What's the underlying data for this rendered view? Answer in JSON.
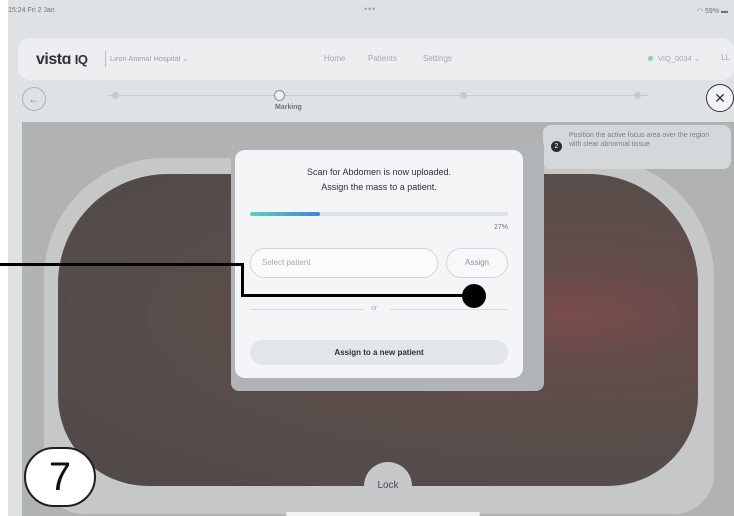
{
  "status_bar": {
    "time": "15:24  Fri 2 Jan",
    "dots": "•••",
    "battery": "59%"
  },
  "nav": {
    "logo_main": "vistɑ",
    "logo_iq": "IQ",
    "hospital": "Liron Animal Hospital ⌄",
    "menu": [
      "Home",
      "Patients",
      "Settings"
    ],
    "device": "VIQ_0034 ⌄",
    "user": "LL"
  },
  "steps": {
    "active_label": "Marking",
    "back_icon": "arrow-left-icon",
    "close_icon": "close-icon"
  },
  "hint": {
    "badge": "2",
    "text": "Position the active focus area over the region with clear abnormal tissue"
  },
  "modal": {
    "line1": "Scan for Abdomen is now uploaded.",
    "line2": "Assign the mass to a patient.",
    "progress_percent": 27,
    "progress_label": "27%",
    "select_placeholder": "Select patient",
    "assign_label": "Assign",
    "or_label": "or",
    "new_patient_label": "Assign to a new patient"
  },
  "lock_label": "Lock",
  "annotation": {
    "step_number": "7"
  },
  "colors": {
    "accent_start": "#5fd0c0",
    "accent_end": "#3b86d8",
    "online": "#8fd49a"
  }
}
